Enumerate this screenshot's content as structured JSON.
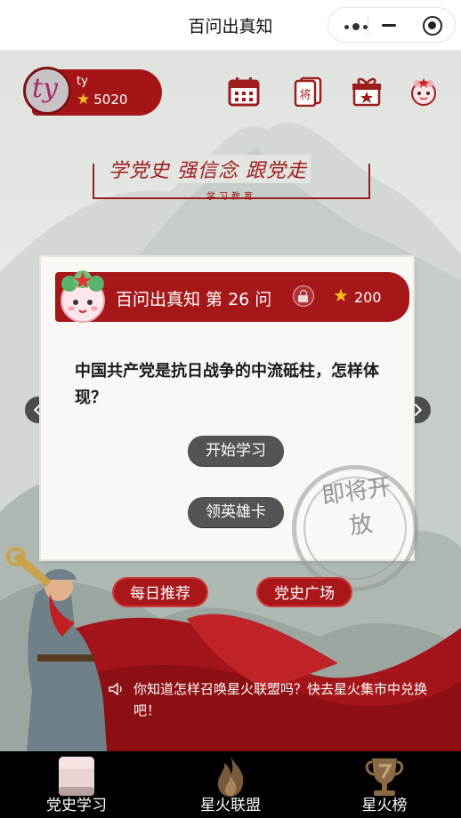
{
  "app": {
    "title": "百问出真知"
  },
  "user": {
    "name": "ty",
    "stars": "5020",
    "avatar_text": "ty"
  },
  "header_icons": [
    "calendar-icon",
    "cards-icon",
    "gift-icon",
    "mascot-profile-icon"
  ],
  "slogan": {
    "main": "学党史 强信念 跟党走",
    "sub": "学习教育"
  },
  "quiz": {
    "banner_title": "百问出真知 第 26 问",
    "reward": "200",
    "question": "中国共产党是抗日战争的中流砥柱，怎样体现？",
    "start_button": "开始学习",
    "hero_card_button": "领英雄卡",
    "seal_text": "即将开放"
  },
  "actions": {
    "daily": "每日推荐",
    "plaza": "党史广场"
  },
  "notice": {
    "text": "你知道怎样召唤星火联盟吗？快去星火集市中兑换吧！"
  },
  "tabs": [
    {
      "label": "党史学习",
      "icon": "book-icon"
    },
    {
      "label": "星火联盟",
      "icon": "flame-icon"
    },
    {
      "label": "星火榜",
      "icon": "trophy-icon"
    }
  ],
  "colors": {
    "brand_red": "#a6171a",
    "star_gold": "#f4c21b",
    "tabbar_bg": "#000000"
  }
}
